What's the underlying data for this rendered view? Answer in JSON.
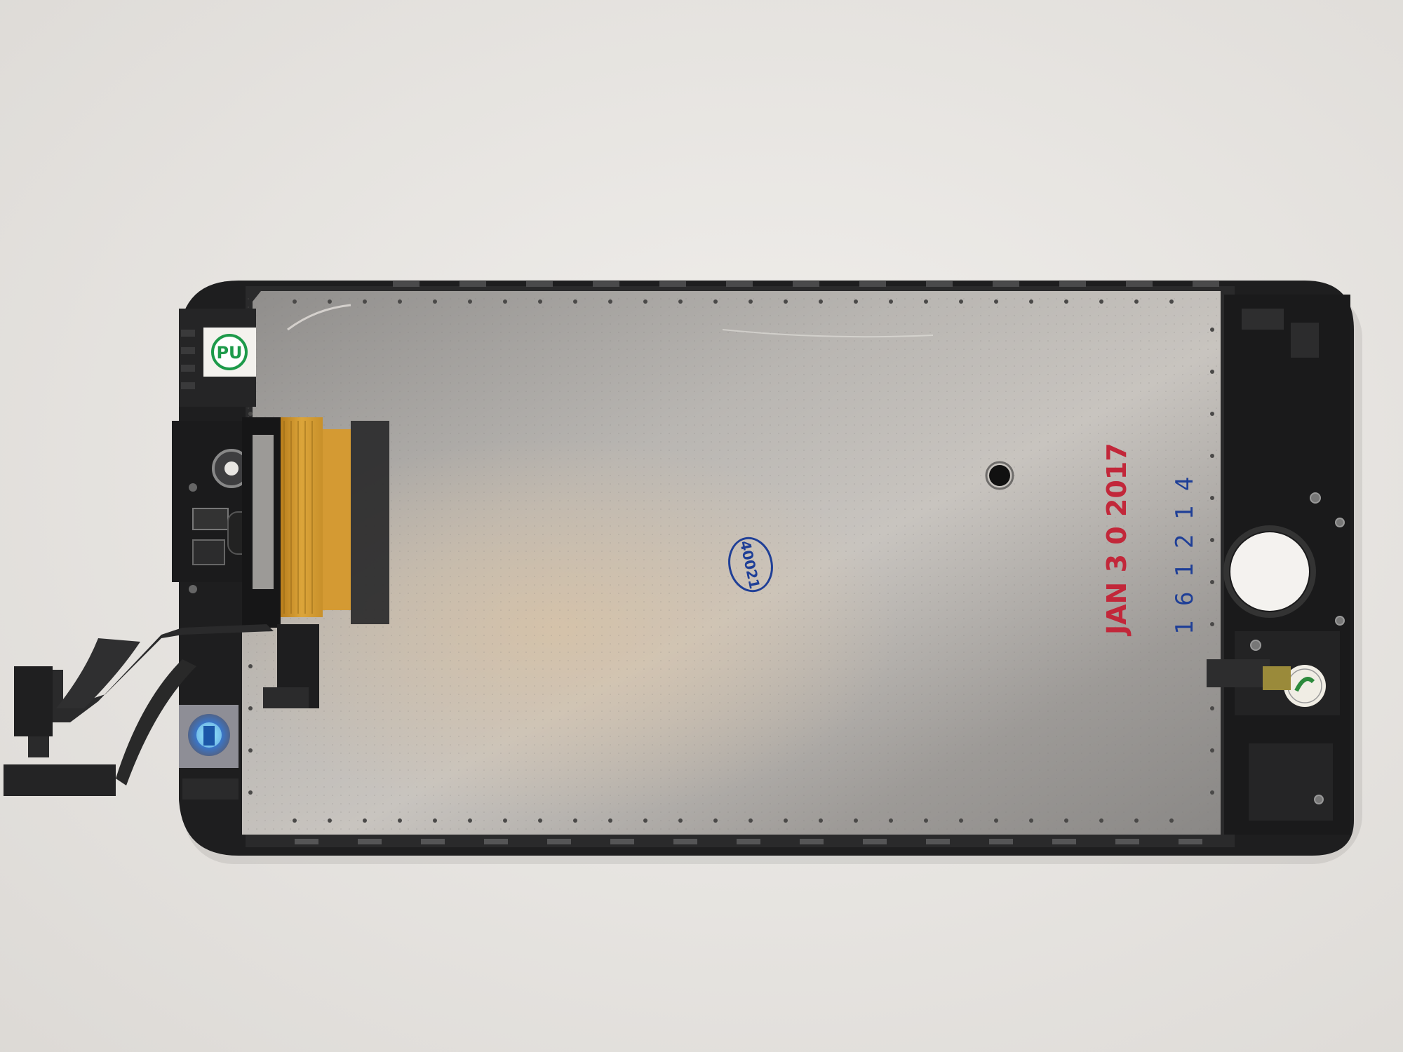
{
  "scene": {
    "description_colors": {
      "background": "#eceae7",
      "frame": "#1e1e1f",
      "shield": "#a9a7a4",
      "flex_cable": "#d79c2c",
      "red_stamp": "#c2273a",
      "blue_stamp": "#1f3f97",
      "pu_green": "#1d9a4a"
    }
  },
  "labels": {
    "pu_sticker": "PU",
    "date_stamp": "JAN 3 0 2017",
    "serial_stamp": "1 6 1 2 1 4",
    "round_stamp": "40021"
  }
}
